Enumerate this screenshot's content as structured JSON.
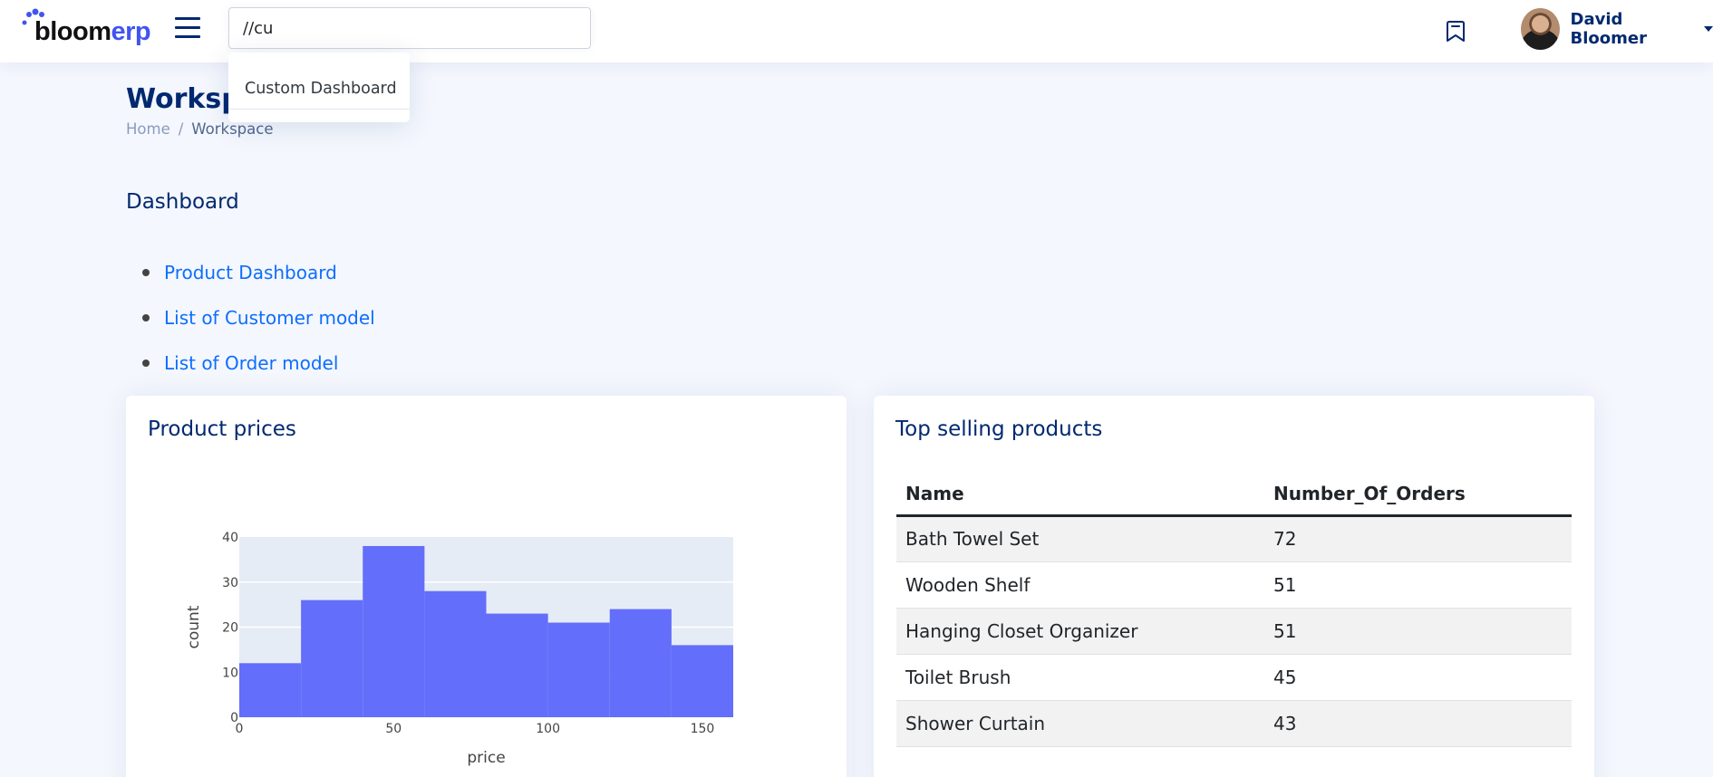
{
  "header": {
    "logo_part1": "bloom",
    "logo_part2": "erp",
    "menu_icon": "hamburger-menu-icon",
    "search": {
      "value": "//cu",
      "placeholder": ""
    },
    "search_suggestions": [
      {
        "label": "Custom Dashboard"
      }
    ],
    "bookmark_icon": "bookmark-icon",
    "user": {
      "name": "David Bloomer"
    }
  },
  "page": {
    "title": "Workspace",
    "breadcrumb": [
      {
        "label": "Home"
      },
      {
        "label": "Workspace"
      }
    ]
  },
  "dashboard": {
    "title": "Dashboard",
    "links": [
      {
        "label": "Product Dashboard"
      },
      {
        "label": "List of Customer model"
      },
      {
        "label": "List of Order model"
      }
    ]
  },
  "cards": {
    "product_prices": {
      "title": "Product prices"
    },
    "top_selling": {
      "title": "Top selling products",
      "columns": [
        "Name",
        "Number_Of_Orders"
      ],
      "rows": [
        [
          "Bath Towel Set",
          "72"
        ],
        [
          "Wooden Shelf",
          "51"
        ],
        [
          "Hanging Closet Organizer",
          "51"
        ],
        [
          "Toilet Brush",
          "45"
        ],
        [
          "Shower Curtain",
          "43"
        ]
      ]
    }
  },
  "colors": {
    "accent": "#4154f1",
    "navy": "#012970",
    "link": "#0d6efd",
    "bar": "#636efa",
    "plot_bg": "#e5ecf6"
  },
  "chart_data": {
    "type": "bar",
    "subtype": "histogram",
    "title": "Product prices",
    "xlabel": "price",
    "ylabel": "count",
    "bins": [
      {
        "start": 0,
        "end": 20,
        "count": 12
      },
      {
        "start": 20,
        "end": 40,
        "count": 26
      },
      {
        "start": 40,
        "end": 60,
        "count": 38
      },
      {
        "start": 60,
        "end": 80,
        "count": 28
      },
      {
        "start": 80,
        "end": 100,
        "count": 23
      },
      {
        "start": 100,
        "end": 120,
        "count": 21
      },
      {
        "start": 120,
        "end": 140,
        "count": 24
      },
      {
        "start": 140,
        "end": 160,
        "count": 16
      }
    ],
    "xlim": [
      0,
      160
    ],
    "ylim": [
      0,
      40
    ],
    "xticks": [
      0,
      50,
      100,
      150
    ],
    "yticks": [
      0,
      10,
      20,
      30,
      40
    ],
    "grid": true,
    "legend": "none"
  }
}
